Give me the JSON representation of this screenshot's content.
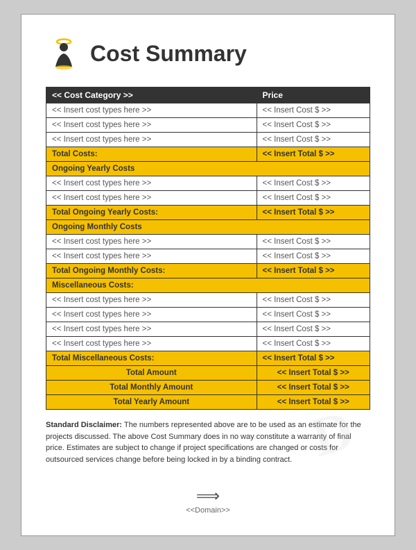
{
  "header": {
    "title": "Cost Summary"
  },
  "table": {
    "col1_header": "<< Cost Category >>",
    "col2_header": "Price",
    "sections": [
      {
        "type": "data_rows",
        "rows": [
          {
            "cat": "<< Insert cost types here >>",
            "price": "<< Insert Cost $ >>"
          },
          {
            "cat": "<< Insert cost types here >>",
            "price": "<< Insert Cost $ >>"
          },
          {
            "cat": "<< Insert cost types here >>",
            "price": "<< Insert Cost $ >>"
          }
        ]
      },
      {
        "type": "total",
        "label": "Total Costs:",
        "value": "<< Insert Total $ >>"
      },
      {
        "type": "section_label",
        "label": "Ongoing Yearly Costs",
        "value": ""
      },
      {
        "type": "data_rows",
        "rows": [
          {
            "cat": "<< Insert cost types here >>",
            "price": "<< Insert Cost $ >>"
          },
          {
            "cat": "<< Insert cost types here >>",
            "price": "<< Insert Cost $ >>"
          }
        ]
      },
      {
        "type": "total",
        "label": "Total Ongoing Yearly Costs:",
        "value": "<< Insert Total $ >>"
      },
      {
        "type": "section_label",
        "label": "Ongoing Monthly Costs",
        "value": ""
      },
      {
        "type": "data_rows",
        "rows": [
          {
            "cat": "<< Insert cost types here >>",
            "price": "<< Insert Cost $ >>"
          },
          {
            "cat": "<< Insert cost types here >>",
            "price": "<< Insert Cost $ >>"
          }
        ]
      },
      {
        "type": "total",
        "label": "Total Ongoing Monthly Costs:",
        "value": "<< Insert Total $ >>"
      },
      {
        "type": "section_label",
        "label": "Miscellaneous Costs:",
        "value": ""
      },
      {
        "type": "data_rows",
        "rows": [
          {
            "cat": "<< Insert cost types here >>",
            "price": "<< Insert Cost $ >>"
          },
          {
            "cat": "<< Insert cost types here >>",
            "price": "<< Insert Cost $ >>"
          },
          {
            "cat": "<< Insert cost types here >>",
            "price": "<< Insert Cost $ >>"
          },
          {
            "cat": "<< Insert cost types here >>",
            "price": "<< Insert Cost $ >>"
          }
        ]
      },
      {
        "type": "total",
        "label": "Total Miscellaneous Costs:",
        "value": "<< Insert Total $ >>"
      }
    ],
    "summary_rows": [
      {
        "label": "Total Amount",
        "value": "<< Insert Total $ >>"
      },
      {
        "label": "Total Monthly Amount",
        "value": "<< Insert Total $ >>"
      },
      {
        "label": "Total Yearly Amount",
        "value": "<< Insert Total $ >>"
      }
    ]
  },
  "disclaimer": {
    "label": "Standard Disclaimer:",
    "text": " The numbers represented above are to be used as an estimate for the projects discussed. The above Cost Summary does in no way constitute a warranty of final price. Estimates are subject to change if project specifications are changed or costs for outsourced services change before being locked in by a binding contract."
  },
  "footer": {
    "label": "<<Domain>>"
  }
}
